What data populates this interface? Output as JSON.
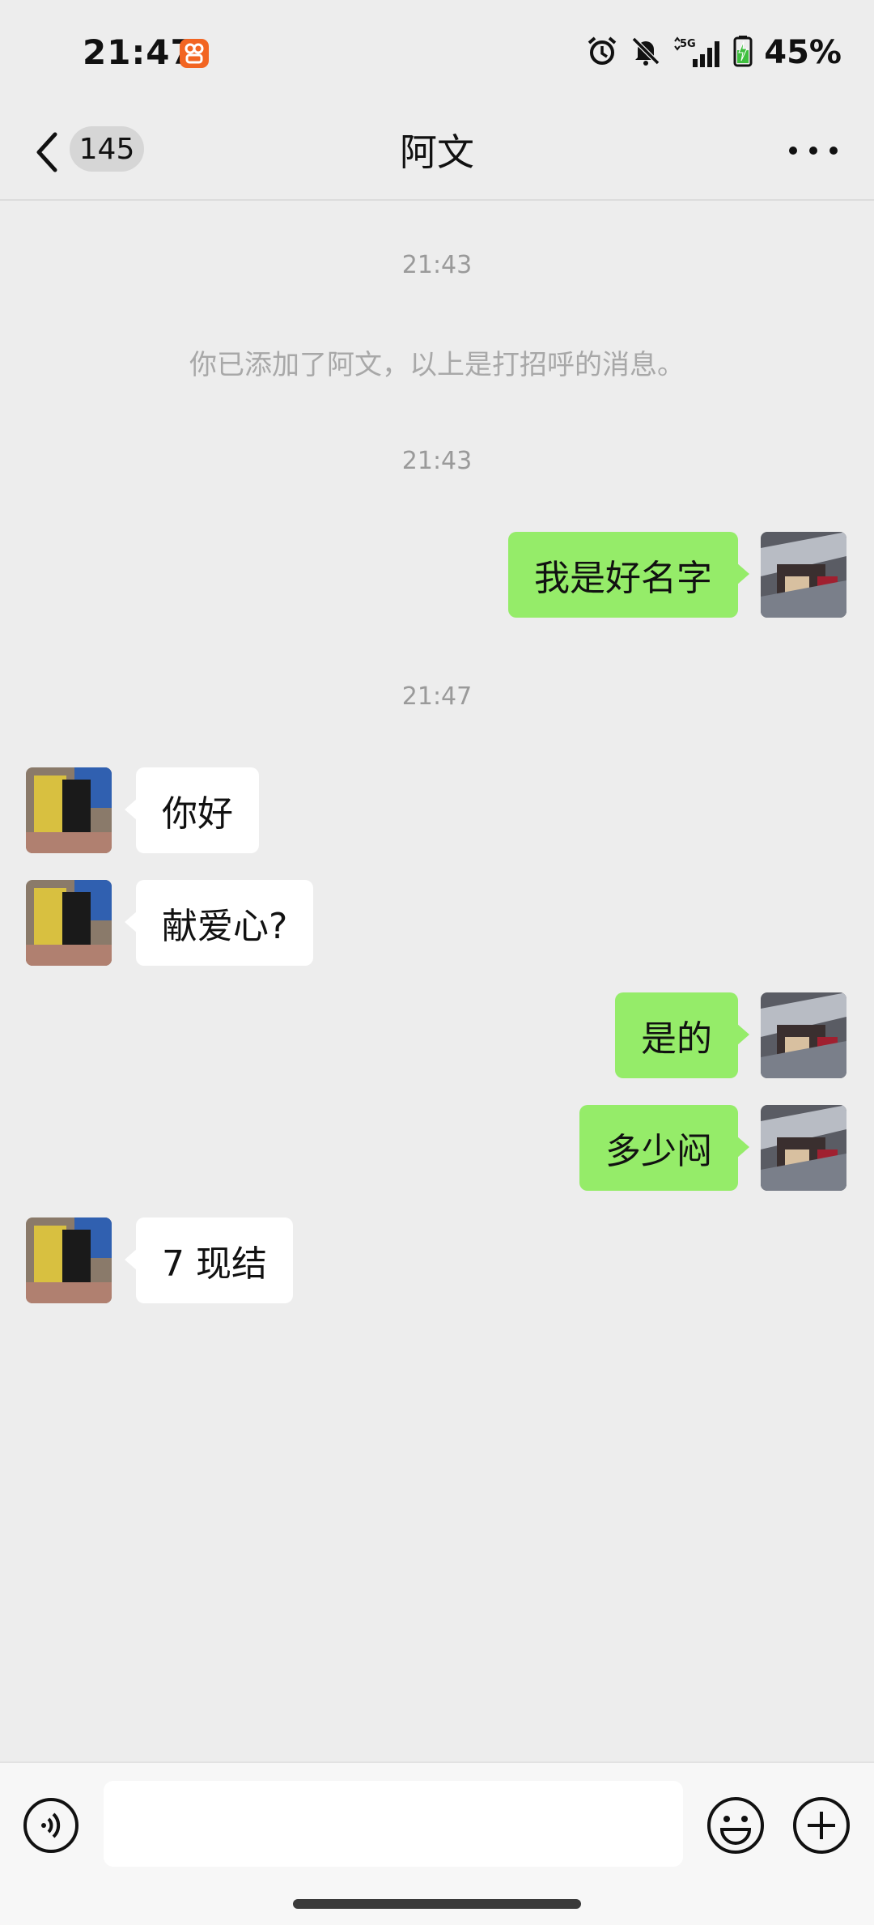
{
  "status_bar": {
    "time": "21:47",
    "network": "5G",
    "battery": "45%",
    "icons": [
      "app-notification-icon",
      "alarm-icon",
      "mute-bell-icon",
      "5g-signal-icon",
      "battery-charging-icon"
    ]
  },
  "header": {
    "unread_count": "145",
    "title": "阿文"
  },
  "timestamps": [
    "21:43",
    "21:43",
    "21:47"
  ],
  "system_message": "你已添加了阿文，以上是打招呼的消息。",
  "messages": [
    {
      "from": "me",
      "text": "我是好名字"
    },
    {
      "from": "other",
      "text": "你好"
    },
    {
      "from": "other",
      "text": "献爱心?"
    },
    {
      "from": "me",
      "text": "是的"
    },
    {
      "from": "me",
      "text": "多少闷"
    },
    {
      "from": "other",
      "text": "7 现结"
    }
  ],
  "input": {
    "value": "",
    "icons": [
      "voice-icon",
      "mic-icon",
      "emoji-icon",
      "plus-icon"
    ]
  },
  "colors": {
    "outgoing_bubble": "#95ec69",
    "incoming_bubble": "#ffffff",
    "background": "#ededed",
    "status_app_icon": "#f26522",
    "battery_fill": "#3fbf3f"
  }
}
